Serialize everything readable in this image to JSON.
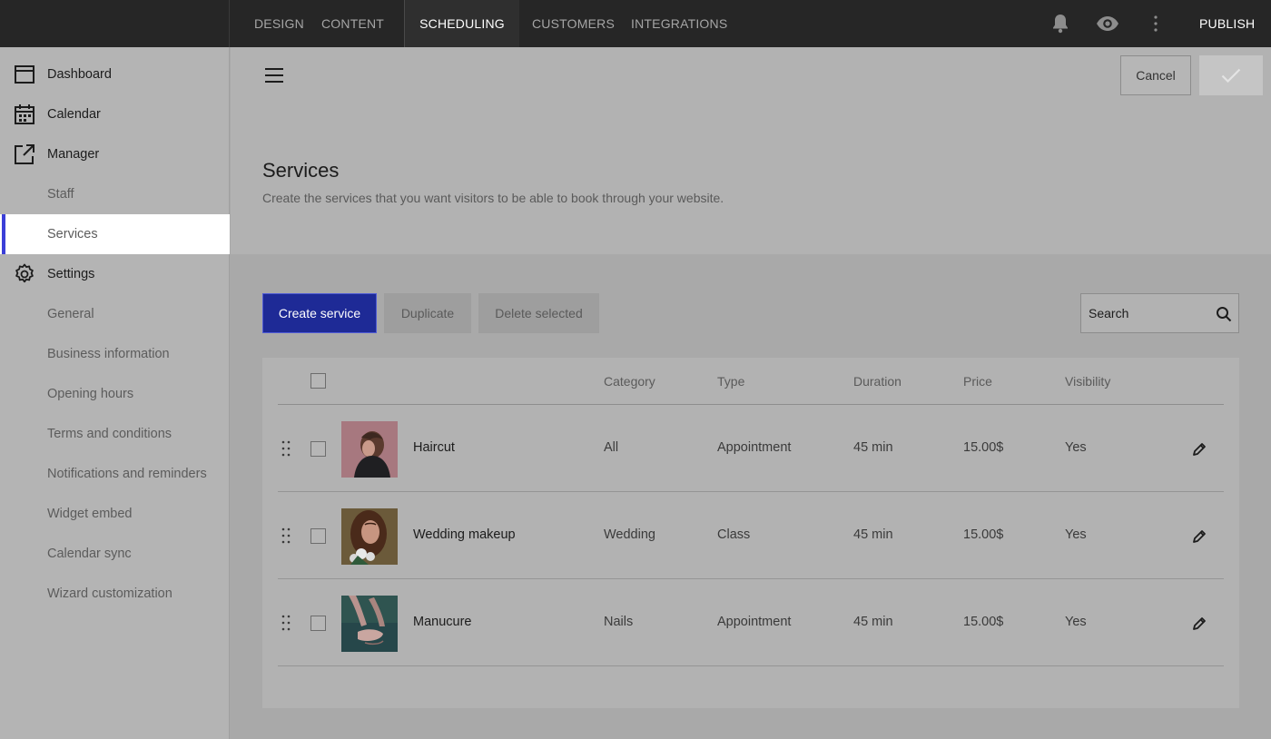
{
  "topbar": {
    "nav": [
      "DESIGN",
      "CONTENT",
      "SCHEDULING",
      "CUSTOMERS",
      "INTEGRATIONS"
    ],
    "active": "SCHEDULING",
    "publish_label": "PUBLISH",
    "icons": [
      "bell-icon",
      "eye-icon",
      "more-vertical-icon"
    ]
  },
  "sidebar": {
    "items": [
      {
        "label": "Dashboard",
        "icon": "dashboard-icon"
      },
      {
        "label": "Calendar",
        "icon": "calendar-icon"
      },
      {
        "label": "Manager",
        "icon": "external-link-icon"
      },
      {
        "label": "Staff"
      },
      {
        "label": "Services"
      },
      {
        "label": "Settings",
        "icon": "gear-icon"
      },
      {
        "label": "General"
      },
      {
        "label": "Business information"
      },
      {
        "label": "Opening hours"
      },
      {
        "label": "Terms and conditions"
      },
      {
        "label": "Notifications and reminders"
      },
      {
        "label": "Widget embed"
      },
      {
        "label": "Calendar sync"
      },
      {
        "label": "Wizard customization"
      }
    ],
    "active": "Services"
  },
  "header": {
    "cancel_label": "Cancel",
    "title": "Services",
    "subtitle": "Create the services that you want visitors to be able to book through your website."
  },
  "toolbar": {
    "create_label": "Create service",
    "duplicate_label": "Duplicate",
    "delete_label": "Delete selected",
    "search_placeholder": "Search"
  },
  "table": {
    "columns": [
      "Category",
      "Type",
      "Duration",
      "Price",
      "Visibility"
    ],
    "rows": [
      {
        "name": "Haircut",
        "category": "All",
        "type": "Appointment",
        "duration": "45 min",
        "price": "15.00$",
        "visibility": "Yes"
      },
      {
        "name": "Wedding makeup",
        "category": "Wedding",
        "type": "Class",
        "duration": "45 min",
        "price": "15.00$",
        "visibility": "Yes"
      },
      {
        "name": "Manucure",
        "category": "Nails",
        "type": "Appointment",
        "duration": "45 min",
        "price": "15.00$",
        "visibility": "Yes"
      }
    ]
  },
  "colors": {
    "accent": "#3b3fd8",
    "primary_button": "#1e2a96",
    "topbar": "#262626"
  }
}
